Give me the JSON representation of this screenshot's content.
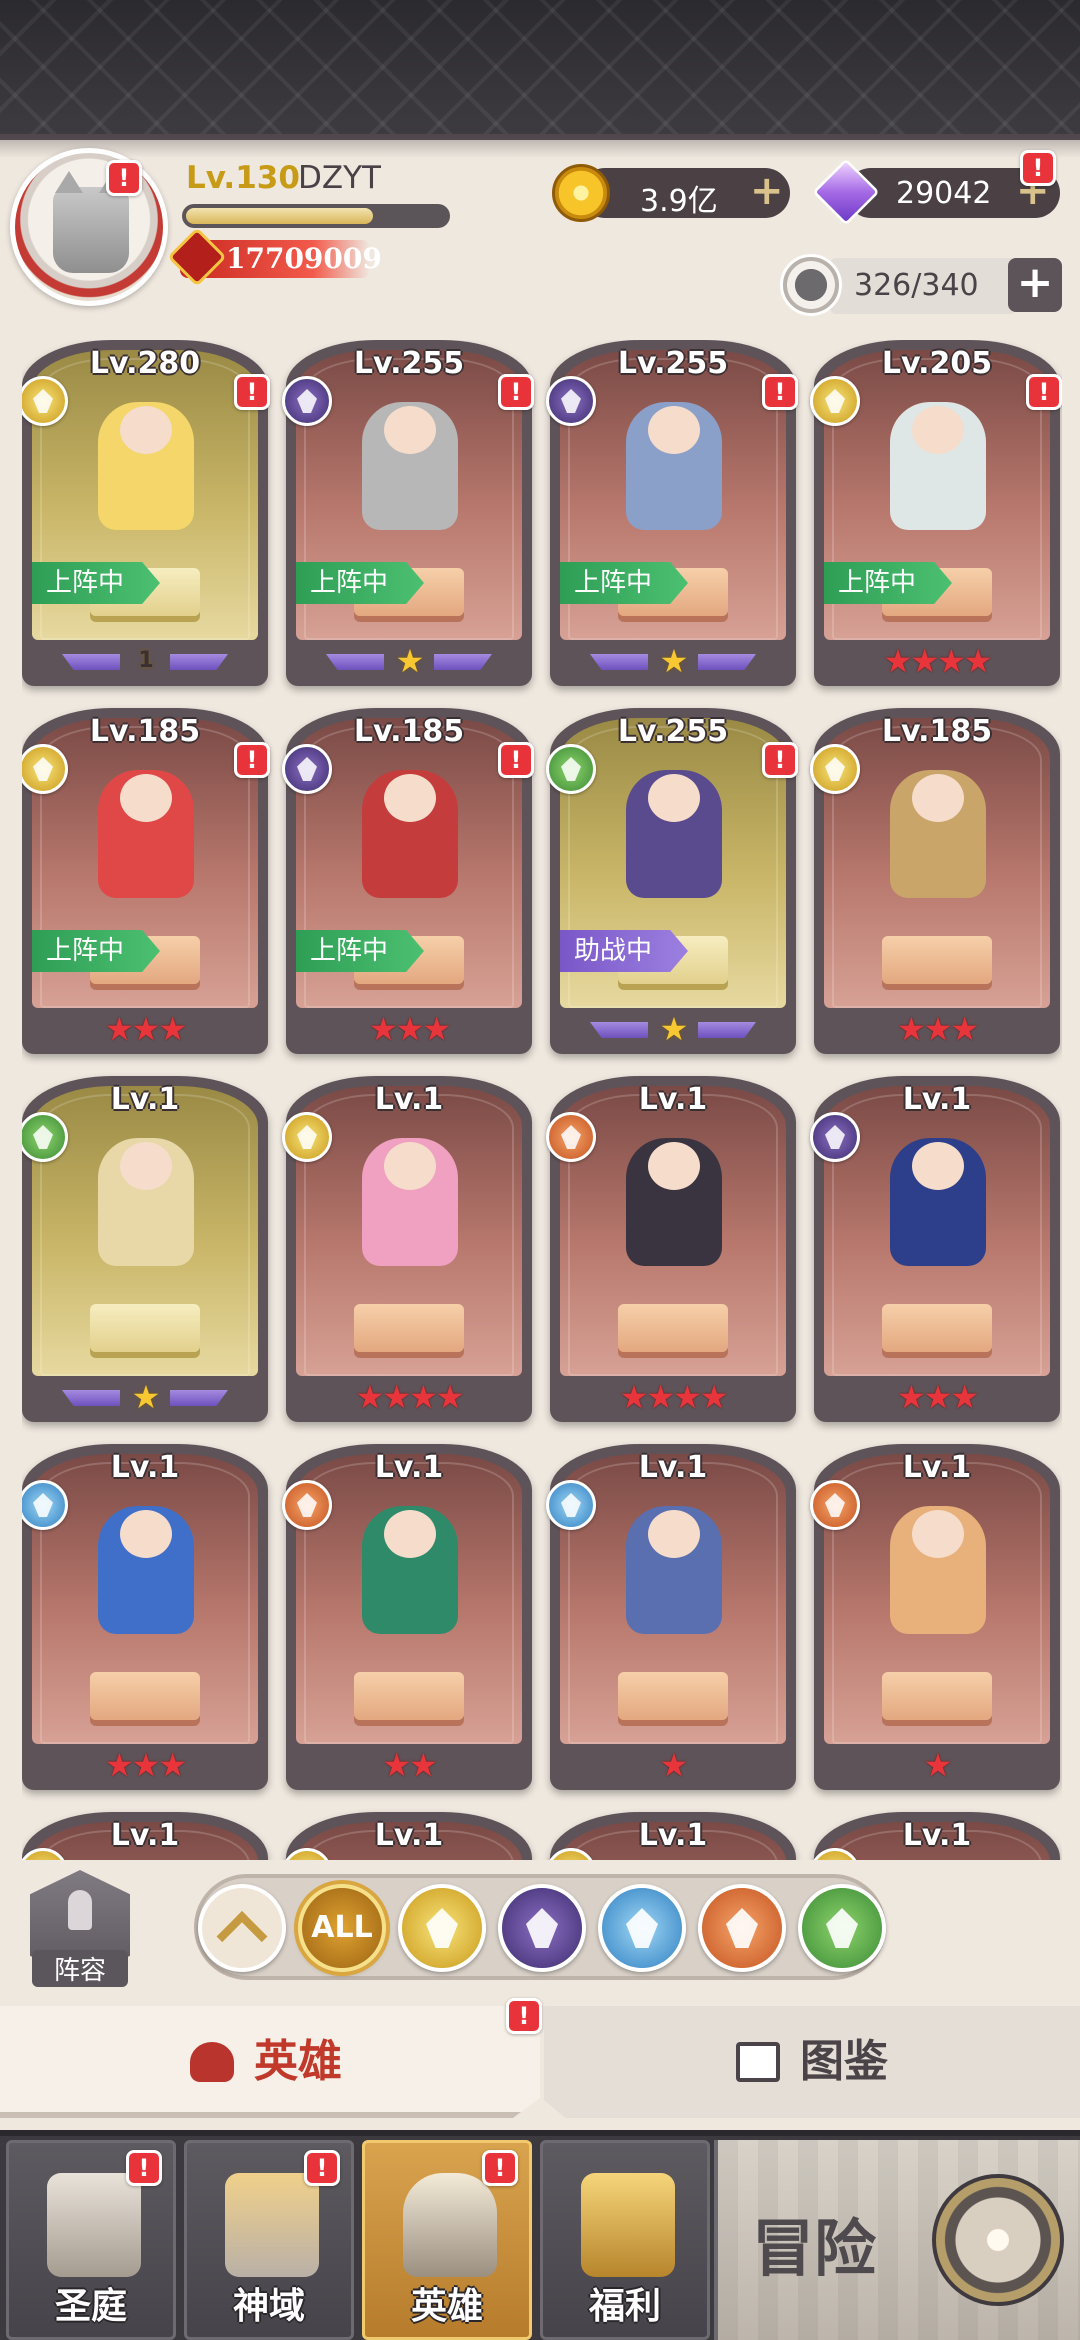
{
  "header": {
    "level": "Lv.130",
    "player_name": "DZYT",
    "exp_fraction": 0.72,
    "power": "17709009",
    "gold": "3.9亿",
    "gems": "29042",
    "capacity": "326/340",
    "alert_mark": "!"
  },
  "heroes": [
    {
      "level": "Lv.280",
      "faction": "light",
      "bg": "gold",
      "status": "上阵中",
      "status_color": "green",
      "stars": "1",
      "star_type": "gold",
      "alert": "!"
    },
    {
      "level": "Lv.255",
      "faction": "dark",
      "bg": "red",
      "status": "上阵中",
      "status_color": "green",
      "stars": "★",
      "star_type": "gold",
      "alert": "!"
    },
    {
      "level": "Lv.255",
      "faction": "dark",
      "bg": "red",
      "status": "上阵中",
      "status_color": "green",
      "stars": "★",
      "star_type": "gold",
      "alert": "!"
    },
    {
      "level": "Lv.205",
      "faction": "light",
      "bg": "red",
      "status": "上阵中",
      "status_color": "green",
      "stars": "★★★★",
      "star_type": "red",
      "alert": "!"
    },
    {
      "level": "Lv.185",
      "faction": "light",
      "bg": "red",
      "status": "上阵中",
      "status_color": "green",
      "stars": "★★★",
      "star_type": "red",
      "alert": "!"
    },
    {
      "level": "Lv.185",
      "faction": "dark",
      "bg": "red",
      "status": "上阵中",
      "status_color": "green",
      "stars": "★★★",
      "star_type": "red",
      "alert": "!"
    },
    {
      "level": "Lv.255",
      "faction": "nature",
      "bg": "gold",
      "status": "助战中",
      "status_color": "purple",
      "stars": "★",
      "star_type": "gold",
      "alert": "!"
    },
    {
      "level": "Lv.185",
      "faction": "light",
      "bg": "red",
      "status": "",
      "status_color": "",
      "stars": "★★★",
      "star_type": "red",
      "alert": ""
    },
    {
      "level": "Lv.1",
      "faction": "nature",
      "bg": "gold",
      "status": "",
      "status_color": "",
      "stars": "★",
      "star_type": "gold",
      "alert": ""
    },
    {
      "level": "Lv.1",
      "faction": "light",
      "bg": "red",
      "status": "",
      "status_color": "",
      "stars": "★★★★",
      "star_type": "red",
      "alert": ""
    },
    {
      "level": "Lv.1",
      "faction": "beast",
      "bg": "red",
      "status": "",
      "status_color": "",
      "stars": "★★★★",
      "star_type": "red",
      "alert": ""
    },
    {
      "level": "Lv.1",
      "faction": "dark",
      "bg": "red",
      "status": "",
      "status_color": "",
      "stars": "★★★",
      "star_type": "red",
      "alert": ""
    },
    {
      "level": "Lv.1",
      "faction": "holy",
      "bg": "red",
      "status": "",
      "status_color": "",
      "stars": "★★★",
      "star_type": "red",
      "alert": ""
    },
    {
      "level": "Lv.1",
      "faction": "beast",
      "bg": "red",
      "status": "",
      "status_color": "",
      "stars": "★★",
      "star_type": "red",
      "alert": ""
    },
    {
      "level": "Lv.1",
      "faction": "holy",
      "bg": "red",
      "status": "",
      "status_color": "",
      "stars": "★",
      "star_type": "red",
      "alert": ""
    },
    {
      "level": "Lv.1",
      "faction": "beast",
      "bg": "red",
      "status": "",
      "status_color": "",
      "stars": "★",
      "star_type": "red",
      "alert": ""
    },
    {
      "level": "Lv.1",
      "faction": "light",
      "bg": "red",
      "status": "",
      "status_color": "",
      "stars": "",
      "star_type": "red",
      "alert": ""
    },
    {
      "level": "Lv.1",
      "faction": "light",
      "bg": "red",
      "status": "",
      "status_color": "",
      "stars": "",
      "star_type": "red",
      "alert": ""
    },
    {
      "level": "Lv.1",
      "faction": "light",
      "bg": "red",
      "status": "",
      "status_color": "",
      "stars": "",
      "star_type": "red",
      "alert": ""
    },
    {
      "level": "Lv.1",
      "faction": "light",
      "bg": "red",
      "status": "",
      "status_color": "",
      "stars": "",
      "star_type": "red",
      "alert": ""
    }
  ],
  "filters": {
    "lineup_label": "阵容",
    "all_label": "ALL",
    "factions": [
      "light",
      "dark",
      "holy",
      "beast",
      "nature"
    ]
  },
  "subtabs": {
    "heroes": "英雄",
    "gallery": "图鉴"
  },
  "nav": {
    "items": [
      {
        "label": "圣庭"
      },
      {
        "label": "神域"
      },
      {
        "label": "英雄"
      },
      {
        "label": "福利"
      }
    ],
    "adventure": "冒险"
  },
  "colors": {
    "light": "#d9a92a",
    "dark": "#5a3f96",
    "nature": "#4a9a3f",
    "holy": "#3f8ecf",
    "beast": "#d8652c",
    "alert": "#e8333a"
  }
}
